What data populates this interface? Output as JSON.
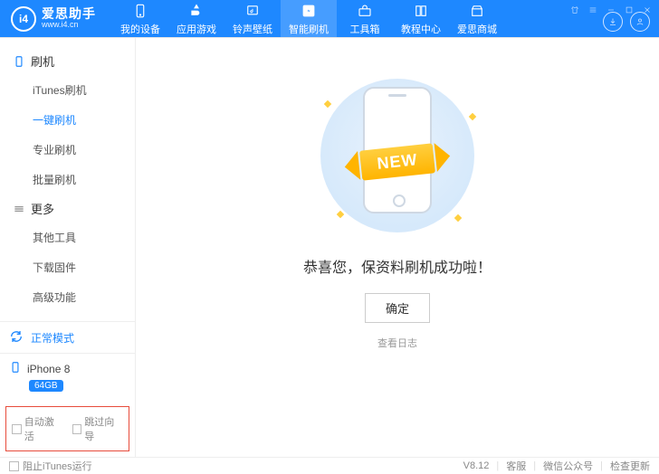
{
  "header": {
    "logo_text": "爱思助手",
    "logo_sub": "www.i4.cn",
    "logo_badge": "i4",
    "nav": [
      {
        "label": "我的设备",
        "icon": "phone"
      },
      {
        "label": "应用游戏",
        "icon": "apps"
      },
      {
        "label": "铃声壁纸",
        "icon": "music"
      },
      {
        "label": "智能刷机",
        "icon": "flash"
      },
      {
        "label": "工具箱",
        "icon": "toolbox"
      },
      {
        "label": "教程中心",
        "icon": "book"
      },
      {
        "label": "爱思商城",
        "icon": "store"
      }
    ]
  },
  "sidebar": {
    "group1": {
      "icon": "flash",
      "label": "刷机"
    },
    "items1": [
      {
        "label": "iTunes刷机"
      },
      {
        "label": "一键刷机"
      },
      {
        "label": "专业刷机"
      },
      {
        "label": "批量刷机"
      }
    ],
    "group2": {
      "icon": "more",
      "label": "更多"
    },
    "items2": [
      {
        "label": "其他工具"
      },
      {
        "label": "下载固件"
      },
      {
        "label": "高级功能"
      }
    ],
    "status_label": "正常模式",
    "device_name": "iPhone 8",
    "device_badge": "64GB",
    "check1": "自动激活",
    "check2": "跳过向导"
  },
  "main": {
    "ribbon": "NEW",
    "message": "恭喜您，保资料刷机成功啦！",
    "confirm": "确定",
    "loglink": "查看日志"
  },
  "footer": {
    "block_itunes": "阻止iTunes运行",
    "version": "V8.12",
    "link1": "客服",
    "link2": "微信公众号",
    "link3": "检查更新"
  }
}
